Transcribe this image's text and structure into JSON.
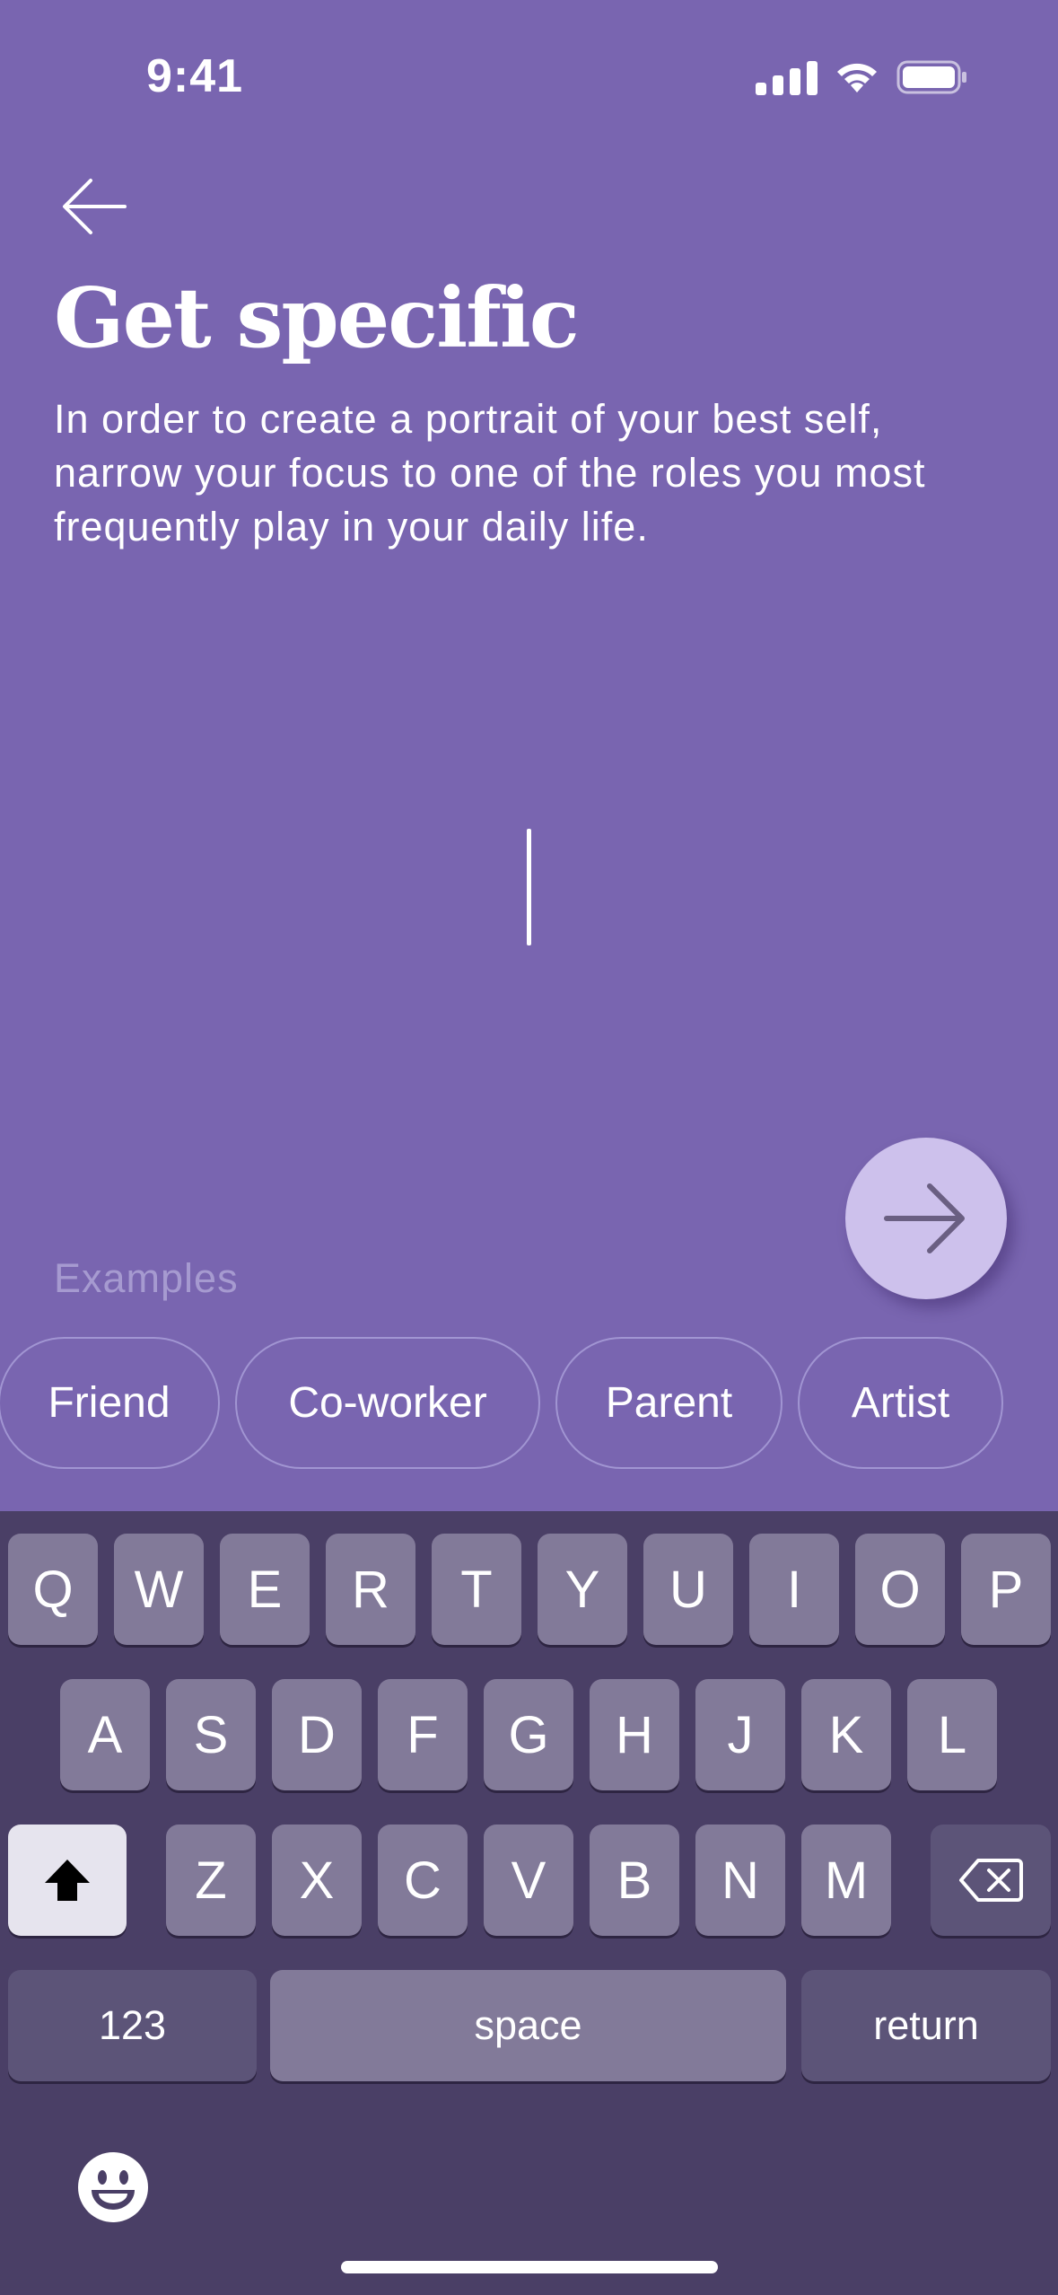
{
  "status_bar": {
    "time": "9:41"
  },
  "header": {
    "title": "Get specific",
    "subtitle": "In order to create a portrait of your best self, narrow your focus to one of the roles you most frequently play in your daily life."
  },
  "input": {
    "value": ""
  },
  "examples": {
    "label": "Examples",
    "chips": [
      "Friend",
      "Co-worker",
      "Parent",
      "Artist"
    ]
  },
  "keyboard": {
    "row1": [
      "Q",
      "W",
      "E",
      "R",
      "T",
      "Y",
      "U",
      "I",
      "O",
      "P"
    ],
    "row2": [
      "A",
      "S",
      "D",
      "F",
      "G",
      "H",
      "J",
      "K",
      "L"
    ],
    "row3": [
      "Z",
      "X",
      "C",
      "V",
      "B",
      "N",
      "M"
    ],
    "numbers_label": "123",
    "space_label": "space",
    "return_label": "return"
  },
  "icons": {
    "back": "arrow-left-icon",
    "next": "arrow-right-icon",
    "shift": "shift-icon",
    "delete": "backspace-icon",
    "emoji": "emoji-icon"
  },
  "colors": {
    "background": "#7965B0",
    "next_button": "#CDC1EC",
    "keyboard": "#4A3F66",
    "key": "#827A99"
  }
}
